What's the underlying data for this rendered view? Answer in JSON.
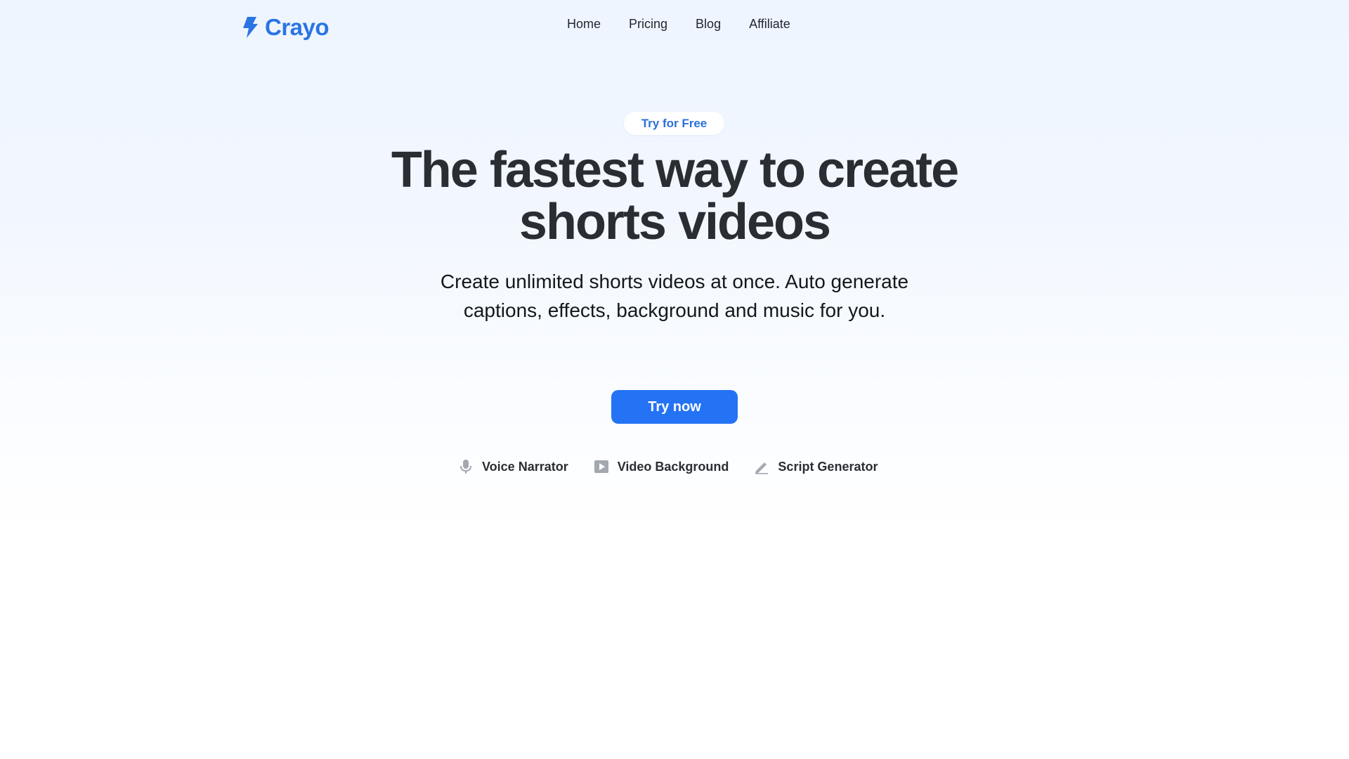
{
  "brand": {
    "name": "Crayo",
    "color": "#2a74e4"
  },
  "nav": {
    "items": [
      {
        "label": "Home"
      },
      {
        "label": "Pricing"
      },
      {
        "label": "Blog"
      },
      {
        "label": "Affiliate"
      }
    ]
  },
  "hero": {
    "badge": "Try for Free",
    "headline_line1": "The fastest way to create",
    "headline_line2": "shorts videos",
    "subtitle": "Create unlimited shorts videos at once. Auto generate captions, effects, background and music for you.",
    "cta_label": "Try now",
    "cta_color": "#2473f4"
  },
  "features": [
    {
      "icon": "microphone-icon",
      "label": "Voice Narrator"
    },
    {
      "icon": "video-play-icon",
      "label": "Video Background"
    },
    {
      "icon": "pencil-icon",
      "label": "Script Generator"
    }
  ],
  "colors": {
    "text_dark": "#2a2e33",
    "badge_text": "#2b6fd9",
    "icon_gray": "#a3a8b0"
  }
}
